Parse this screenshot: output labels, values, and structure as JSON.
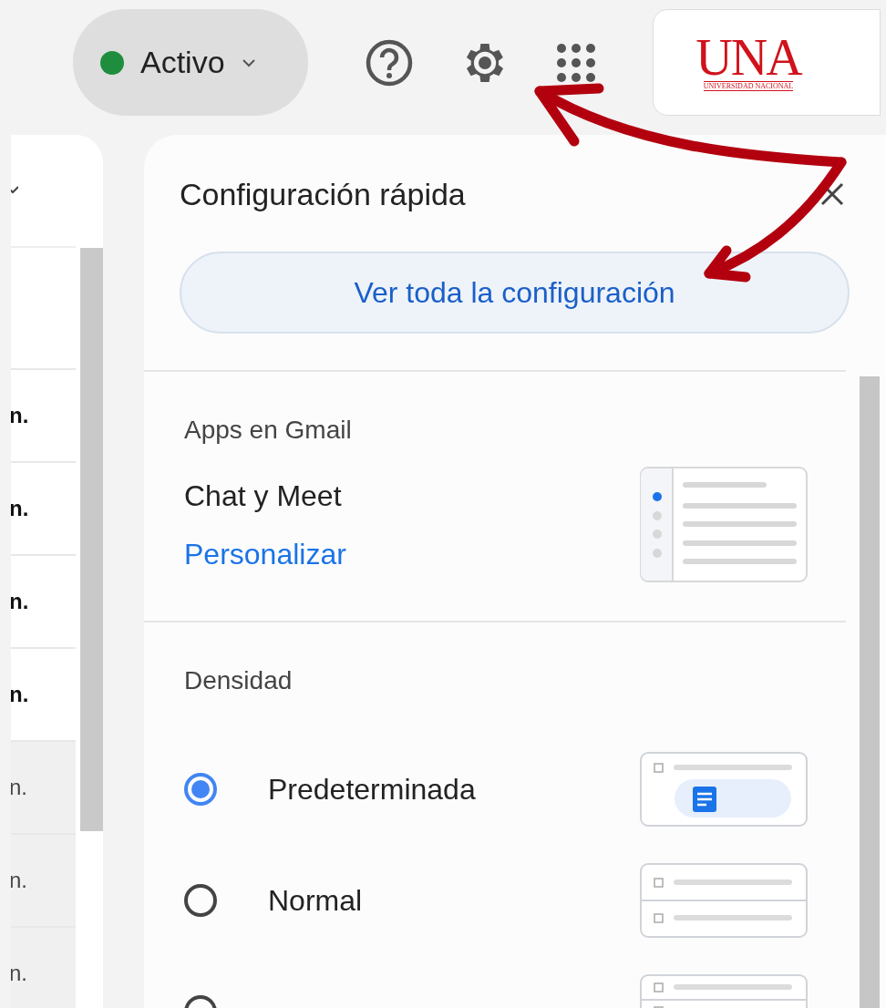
{
  "top_bar": {
    "status": {
      "label": "Activo"
    },
    "logo": {
      "name": "UNA",
      "subtitle": "UNIVERSIDAD NACIONAL"
    }
  },
  "message_list": {
    "rows": [
      {
        "time": "n.",
        "unread": true
      },
      {
        "time": "n.",
        "unread": true
      },
      {
        "time": "n.",
        "unread": true
      },
      {
        "time": "n.",
        "unread": true
      },
      {
        "time": "n.",
        "unread": false
      },
      {
        "time": "n.",
        "unread": false
      },
      {
        "time": "n.",
        "unread": false
      }
    ]
  },
  "quick_settings": {
    "title": "Configuración rápida",
    "all_settings_button": "Ver toda la configuración",
    "sections": [
      {
        "kind": "apps",
        "heading": "Apps en Gmail",
        "item": "Chat y Meet",
        "link": "Personalizar"
      },
      {
        "kind": "density",
        "heading": "Densidad",
        "options": [
          {
            "label": "Predeterminada",
            "selected": true
          },
          {
            "label": "Normal",
            "selected": false
          },
          {
            "selected": false
          }
        ]
      }
    ]
  }
}
